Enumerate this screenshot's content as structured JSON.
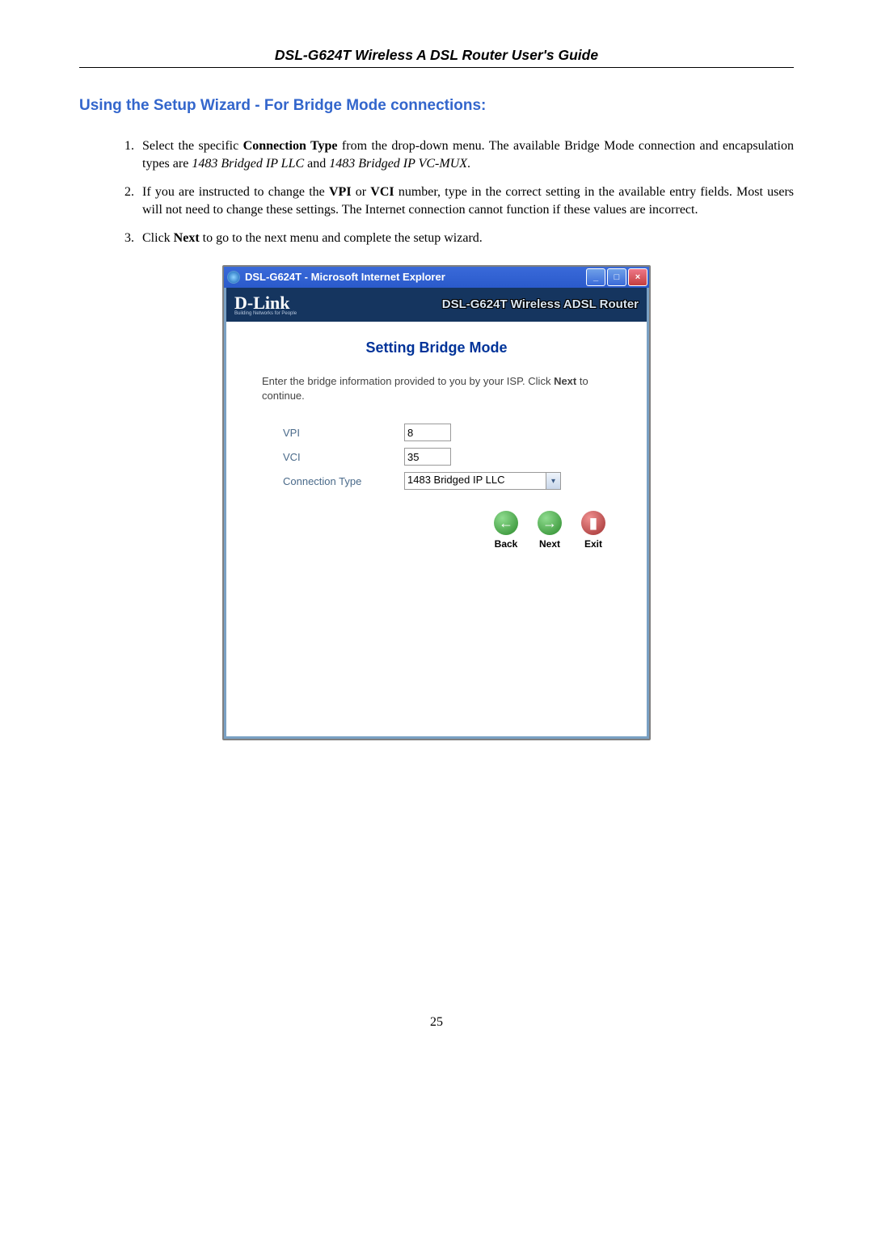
{
  "header": {
    "running_title": "DSL-G624T Wireless A DSL Router User's Guide"
  },
  "section": {
    "heading": "Using the Setup Wizard - For Bridge Mode connections:"
  },
  "steps": {
    "s1_a": "Select the specific ",
    "s1_b": "Connection Type",
    "s1_c": " from the drop-down menu. The available Bridge Mode connection and encapsulation types are ",
    "s1_d": "1483 Bridged IP LLC",
    "s1_e": " and ",
    "s1_f": "1483 Bridged IP VC-MUX",
    "s1_g": ".",
    "s2_a": "If you are instructed to change the ",
    "s2_b": "VPI",
    "s2_c": " or ",
    "s2_d": "VCI",
    "s2_e": " number, type in the correct setting in the available entry fields. Most users will not need to change these settings. The Internet connection cannot function if these values are incorrect.",
    "s3_a": "Click ",
    "s3_b": "Next",
    "s3_c": " to go to the next menu and complete the setup wizard."
  },
  "window": {
    "title": "DSL-G624T - Microsoft Internet Explorer",
    "dlink_logo": "D-Link",
    "dlink_sub": "Building Networks for People",
    "banner": "DSL-G624T Wireless ADSL Router"
  },
  "wizard": {
    "heading": "Setting Bridge Mode",
    "desc_a": "Enter the bridge information provided to you by your ISP. Click ",
    "desc_b": "Next",
    "desc_c": " to continue.",
    "labels": {
      "vpi": "VPI",
      "vci": "VCI",
      "ctype": "Connection Type"
    },
    "values": {
      "vpi": "8",
      "vci": "35",
      "ctype": "1483 Bridged IP LLC"
    },
    "buttons": {
      "back": "Back",
      "next": "Next",
      "exit": "Exit",
      "back_glyph": "←",
      "next_glyph": "→",
      "exit_glyph": "▮"
    }
  },
  "page_number": "25"
}
